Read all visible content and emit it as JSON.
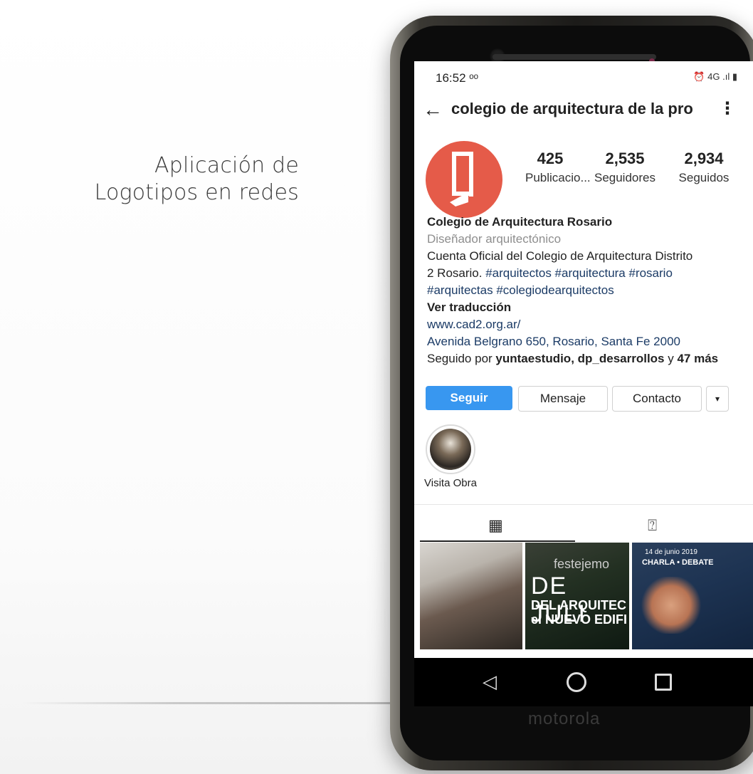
{
  "caption": {
    "line1": "Aplicación de",
    "line2": "Logotipos en redes"
  },
  "phone": {
    "status": {
      "time": "16:52 ᵒᵒ",
      "right": "⏰ 4G .ıl ▮"
    },
    "header": {
      "back": "←",
      "username": "colegio de arquitectura de la pro",
      "more": "⋮"
    },
    "stats": [
      {
        "num": "425",
        "label": "Publicacio..."
      },
      {
        "num": "2,535",
        "label": "Seguidores"
      },
      {
        "num": "2,934",
        "label": "Seguidos"
      }
    ],
    "bio": {
      "name": "Colegio de Arquitectura Rosario",
      "category": "Diseñador arquitectónico",
      "line1": "Cuenta Oficial del Colegio de Arquitectura Distrito",
      "line2_plain": "2 Rosario. ",
      "line2_tags": "#arquitectos #arquitectura #rosario",
      "line3_tags": "#arquitectas #colegiodearquitectos",
      "translate": "Ver traducción",
      "website": "www.cad2.org.ar/",
      "address": "Avenida Belgrano 650, Rosario, Santa Fe 2000",
      "followed_prefix": "Seguido por ",
      "followed_users": "yuntaestudio, dp_desarrollos",
      "followed_mid": " y ",
      "followed_more": "47 más"
    },
    "buttons": {
      "follow": "Seguir",
      "message": "Mensaje",
      "contact": "Contacto",
      "dropdown": "▾"
    },
    "highlight": {
      "label": "Visita Obra"
    },
    "tabs": {
      "grid": "▦",
      "tagged": "⍰"
    },
    "posts": {
      "p2_l1": "festejemo",
      "p2_l2": "DE JULI",
      "p2_l3": "DEL ARQUITEC",
      "p2_l4": "el NUEVO EDIFI",
      "p3_l1": "14 de junio 2019",
      "p3_l2": "CHARLA • DEBATE"
    },
    "nav": {
      "back": "◁"
    },
    "brand": "motorola"
  }
}
